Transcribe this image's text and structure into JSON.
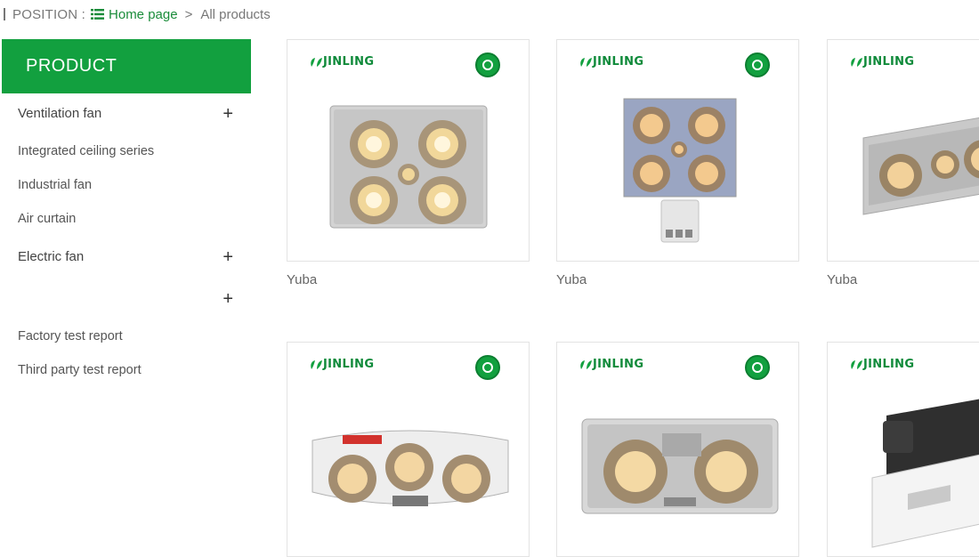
{
  "breadcrumb": {
    "position_label": "POSITION :",
    "home": "Home page",
    "separator": ">",
    "current": "All products"
  },
  "sidebar": {
    "title": "PRODUCT",
    "items": [
      {
        "label": "Ventilation fan",
        "expandable": true
      },
      {
        "label": "Integrated ceiling series",
        "expandable": false
      },
      {
        "label": "Industrial fan",
        "expandable": false
      },
      {
        "label": "Air curtain",
        "expandable": false
      },
      {
        "label": "Electric fan",
        "expandable": true
      },
      {
        "label": "",
        "expandable": true
      },
      {
        "label": "Factory test report",
        "expandable": false
      },
      {
        "label": "Third party test report",
        "expandable": false
      }
    ],
    "plus_symbol": "+"
  },
  "products": [
    {
      "name": "Yuba",
      "brand": "JINLING"
    },
    {
      "name": "Yuba",
      "brand": "JINLING"
    },
    {
      "name": "Yuba",
      "brand": "JINLING"
    },
    {
      "name": "",
      "brand": "JINLING"
    },
    {
      "name": "",
      "brand": "JINLING"
    },
    {
      "name": "",
      "brand": "JINLING"
    }
  ],
  "colors": {
    "accent": "#12a03f",
    "link": "#1a8c3a"
  }
}
